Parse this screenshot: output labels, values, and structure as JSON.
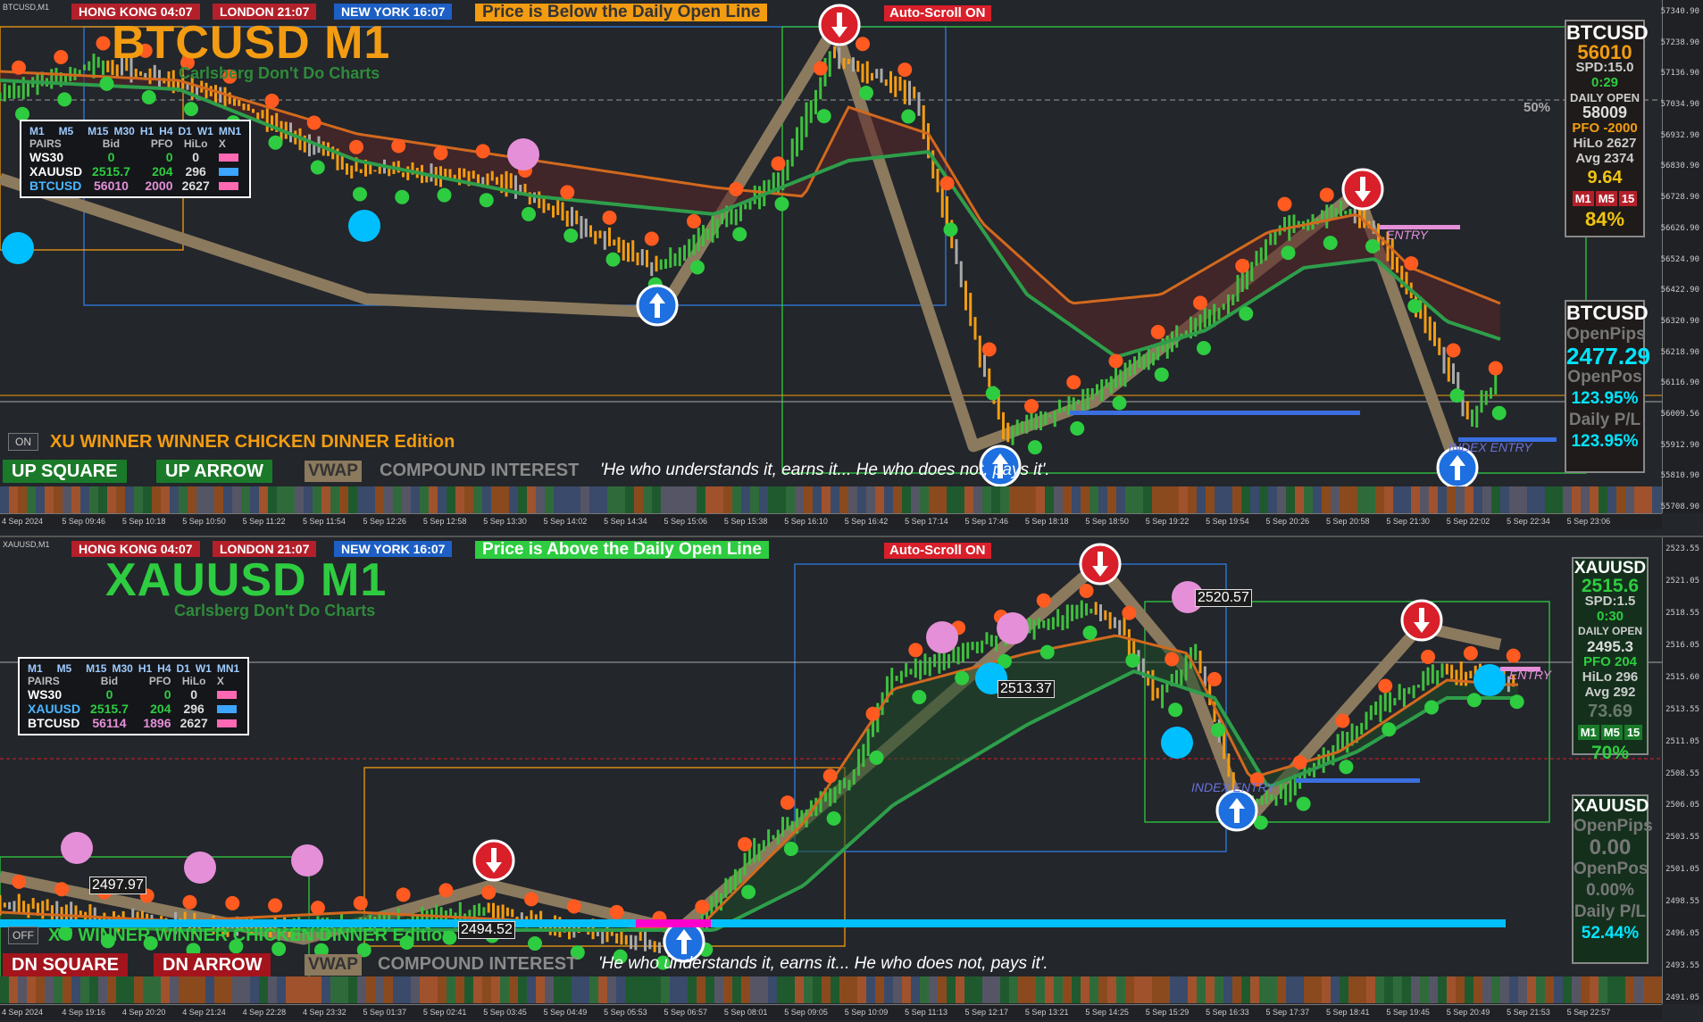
{
  "top": {
    "symbol_tag": "BTCUSD,M1",
    "sessions": {
      "hk": "HONG KONG 04:07",
      "london": "LONDON  21:07",
      "ny": "NEW YORK 16:07"
    },
    "banner": "Price is Below the Daily Open Line",
    "autoscroll": "Auto-Scroll ON",
    "title": "BTCUSD M1",
    "subtitle": "Carlsberg Don't Do Charts",
    "pct_label": "50%",
    "table": {
      "timeframes": [
        "M1",
        "M5",
        "M15",
        "M30",
        "H1",
        "H4",
        "D1",
        "W1",
        "MN1"
      ],
      "headers": [
        "PAIRS",
        "Bid",
        "PFO",
        "HiLo",
        "X"
      ],
      "rows": [
        {
          "pair": "WS30",
          "bid": "0",
          "pfo": "0",
          "hilo": "0"
        },
        {
          "pair": "XAUUSD",
          "bid": "2515.7",
          "pfo": "204",
          "hilo": "296"
        },
        {
          "pair": "BTCUSD",
          "bid": "56010",
          "pfo": "2000",
          "hilo": "2627"
        }
      ]
    },
    "on_badge": "ON",
    "edition": "XU WINNER WINNER CHICKEN DINNER Edition",
    "btn_square": "UP SQUARE",
    "btn_arrow": "UP ARROW",
    "vwap": "VWAP",
    "compound": "COMPOUND INTEREST",
    "quote": "'He who understands it, earns it... He who does not, pays it'.",
    "entry_label1": "ENTRY",
    "entry_label2": "INDEX ENTRY",
    "info": {
      "symbol": "BTCUSD",
      "price": "56010",
      "spread": "SPD:15.0",
      "timer": "0:29",
      "daily_open_label": "DAILY OPEN",
      "daily_open": "58009",
      "pfo": "PFO -2000",
      "hilo": "HiLo 2627",
      "avg": "Avg  2374",
      "ratio": "9.64",
      "tf": [
        "M1",
        "M5",
        "15"
      ],
      "pct": "84%"
    },
    "pl": {
      "symbol": "BTCUSD",
      "open_pips_label": "OpenPips",
      "open_pips": "2477.29",
      "open_pos_label": "OpenPos",
      "open_pos": "123.95%",
      "daily_pl_label": "Daily P/L",
      "daily_pl": "123.95%"
    },
    "price_ticks": [
      "57340.90",
      "57238.90",
      "57136.90",
      "57034.90",
      "56932.90",
      "56830.90",
      "56728.90",
      "56626.90",
      "56524.90",
      "56422.90",
      "56320.90",
      "56218.90",
      "56116.90",
      "56009.56",
      "55912.90",
      "55810.90",
      "55708.90"
    ],
    "time_ticks": [
      "4 Sep 2024",
      "5 Sep 09:46",
      "5 Sep 10:18",
      "5 Sep 10:50",
      "5 Sep 11:22",
      "5 Sep 11:54",
      "5 Sep 12:26",
      "5 Sep 12:58",
      "5 Sep 13:30",
      "5 Sep 14:02",
      "5 Sep 14:34",
      "5 Sep 15:06",
      "5 Sep 15:38",
      "5 Sep 16:10",
      "5 Sep 16:42",
      "5 Sep 17:14",
      "5 Sep 17:46",
      "5 Sep 18:18",
      "5 Sep 18:50",
      "5 Sep 19:22",
      "5 Sep 19:54",
      "5 Sep 20:26",
      "5 Sep 20:58",
      "5 Sep 21:30",
      "5 Sep 22:02",
      "5 Sep 22:34",
      "5 Sep 23:06"
    ]
  },
  "bottom": {
    "symbol_tag": "XAUUSD,M1",
    "sessions": {
      "hk": "HONG KONG 04:07",
      "london": "LONDON  21:07",
      "ny": "NEW YORK 16:07"
    },
    "banner": "Price is Above the Daily Open Line",
    "autoscroll": "Auto-Scroll ON",
    "title": "XAUUSD M1",
    "subtitle": "Carlsberg Don't Do Charts",
    "table": {
      "timeframes": [
        "M1",
        "M5",
        "M15",
        "M30",
        "H1",
        "H4",
        "D1",
        "W1",
        "MN1"
      ],
      "headers": [
        "PAIRS",
        "Bid",
        "PFO",
        "HiLo",
        "X"
      ],
      "rows": [
        {
          "pair": "WS30",
          "bid": "0",
          "pfo": "0",
          "hilo": "0"
        },
        {
          "pair": "XAUUSD",
          "bid": "2515.7",
          "pfo": "204",
          "hilo": "296"
        },
        {
          "pair": "BTCUSD",
          "bid": "56114",
          "pfo": "1896",
          "hilo": "2627"
        }
      ]
    },
    "on_badge": "OFF",
    "edition": "XU WINNER WINNER CHICKEN DINNER Edition",
    "btn_square": "DN SQUARE",
    "btn_arrow": "DN ARROW",
    "vwap": "VWAP",
    "compound": "COMPOUND INTEREST",
    "quote": "'He who understands it, earns it... He who does not, pays it'.",
    "price_labels": [
      "2520.57",
      "2513.37",
      "2497.97",
      "2494.52"
    ],
    "entry_label1": "ENTRY",
    "entry_label2": "INDEX ENTRY",
    "info": {
      "symbol": "XAUUSD",
      "price": "2515.6",
      "spread": "SPD:1.5",
      "timer": "0:30",
      "daily_open_label": "DAILY OPEN",
      "daily_open": "2495.3",
      "pfo": "PFO   204",
      "hilo": "HiLo  296",
      "avg": "Avg   292",
      "ratio": "73.69",
      "tf": [
        "M1",
        "M5",
        "15"
      ],
      "pct": "70%"
    },
    "pl": {
      "symbol": "XAUUSD",
      "open_pips_label": "OpenPips",
      "open_pips": "0.00",
      "open_pos_label": "OpenPos",
      "open_pos": "0.00%",
      "daily_pl_label": "Daily P/L",
      "daily_pl": "52.44%"
    },
    "price_ticks": [
      "2523.55",
      "2521.05",
      "2518.55",
      "2516.05",
      "2515.60",
      "2513.55",
      "2511.05",
      "2508.55",
      "2506.05",
      "2503.55",
      "2501.05",
      "2498.55",
      "2496.05",
      "2493.55",
      "2491.05"
    ],
    "time_ticks": [
      "4 Sep 2024",
      "4 Sep 19:16",
      "4 Sep 20:20",
      "4 Sep 21:24",
      "4 Sep 22:28",
      "4 Sep 23:32",
      "5 Sep 01:37",
      "5 Sep 02:41",
      "5 Sep 03:45",
      "5 Sep 04:49",
      "5 Sep 05:53",
      "5 Sep 06:57",
      "5 Sep 08:01",
      "5 Sep 09:05",
      "5 Sep 10:09",
      "5 Sep 11:13",
      "5 Sep 12:17",
      "5 Sep 13:21",
      "5 Sep 14:25",
      "5 Sep 15:29",
      "5 Sep 16:33",
      "5 Sep 17:37",
      "5 Sep 18:41",
      "5 Sep 19:45",
      "5 Sep 20:49",
      "5 Sep 21:53",
      "5 Sep 22:57"
    ]
  },
  "colors": {
    "bull": "#3fbf3f",
    "bear": "#f39c12",
    "ema": "#d2691e",
    "slow": "#2e9e4a",
    "up_dot": "#2ecc40",
    "down_dot": "#ff5a1f",
    "cyan": "#00bfff",
    "pink": "#e58fd8"
  }
}
